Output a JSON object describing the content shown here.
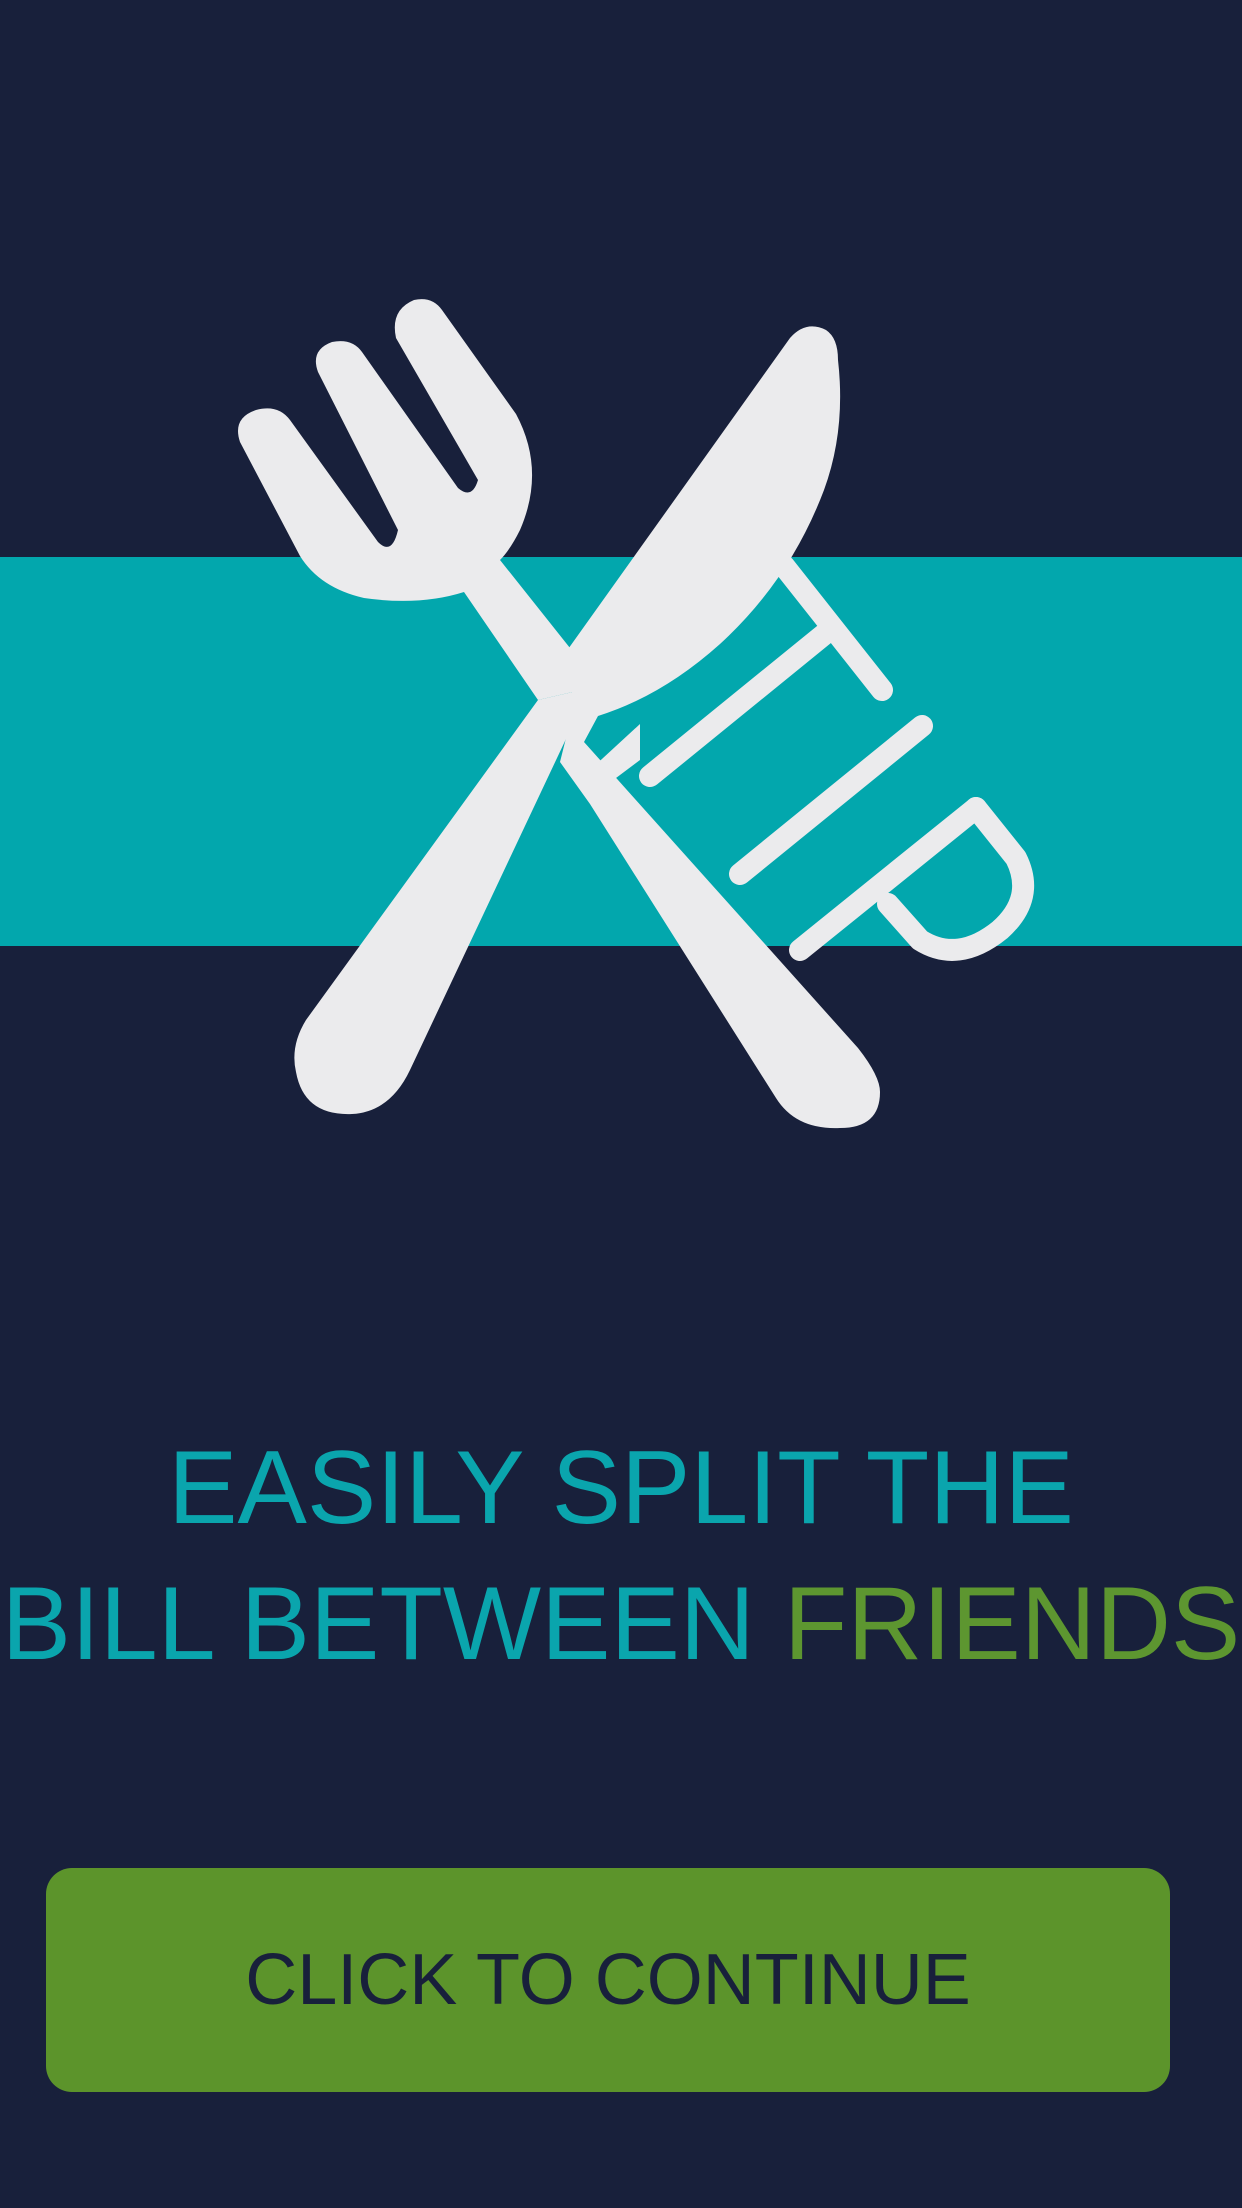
{
  "app": {
    "logo_text": "TIP",
    "icon": "fork-and-knife-icon"
  },
  "headline": {
    "line1": "EASILY SPLIT THE",
    "line2_prefix": "BILL BETWEEN",
    "line2_accent": "FRIENDS"
  },
  "cta": {
    "label": "CLICK TO CONTINUE"
  },
  "colors": {
    "background": "#18203b",
    "band": "#02a7ad",
    "headline": "#0aa5ad",
    "accent": "#5d9630",
    "button": "#5c942b",
    "icon": "#ebebed"
  }
}
